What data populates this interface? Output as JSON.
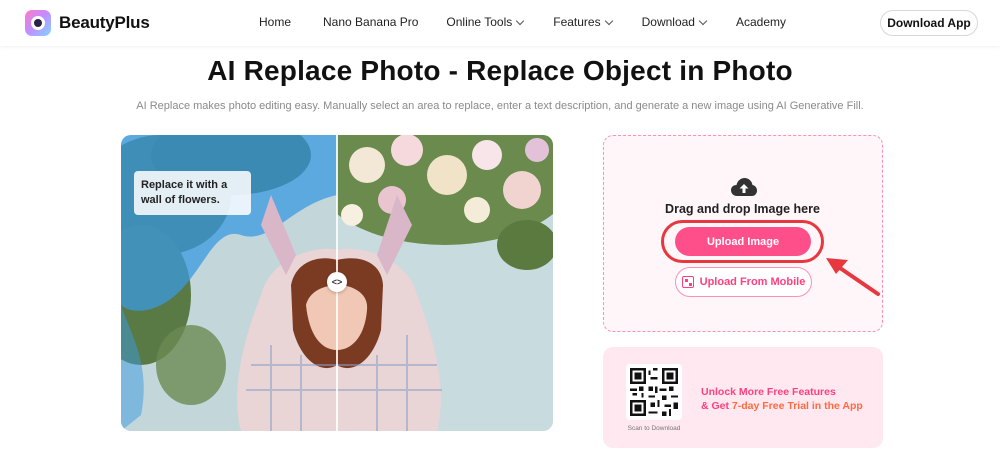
{
  "header": {
    "brand": "BeautyPlus",
    "nav": [
      {
        "label": "Home",
        "dropdown": false
      },
      {
        "label": "Nano Banana Pro",
        "dropdown": false
      },
      {
        "label": "Online Tools",
        "dropdown": true
      },
      {
        "label": "Features",
        "dropdown": true
      },
      {
        "label": "Download",
        "dropdown": true
      },
      {
        "label": "Academy",
        "dropdown": false
      }
    ],
    "download_app": "Download App"
  },
  "main": {
    "title": "AI Replace Photo - Replace Object in Photo",
    "subtitle": "AI Replace makes photo editing easy. Manually select an area to replace, enter a text description, and generate a new image using AI Generative Fill."
  },
  "demo": {
    "prompt_text": "Replace it with a wall of flowers.",
    "handle_glyph": "<>"
  },
  "upload": {
    "drag_text": "Drag and drop Image here",
    "upload_button": "Upload Image",
    "mobile_button": "Upload From Mobile",
    "icon": "cloud-upload-icon"
  },
  "promo": {
    "scan_label": "Scan to Download",
    "line1": "Unlock More Free Features",
    "line2_prefix": "& Get ",
    "line2_highlight": "7-day Free Trial in the App"
  },
  "colors": {
    "accent": "#ff4f8b",
    "highlight_ring": "#e8383f",
    "panel_bg": "#fff6f9",
    "promo_bg": "#ffe8f0"
  }
}
